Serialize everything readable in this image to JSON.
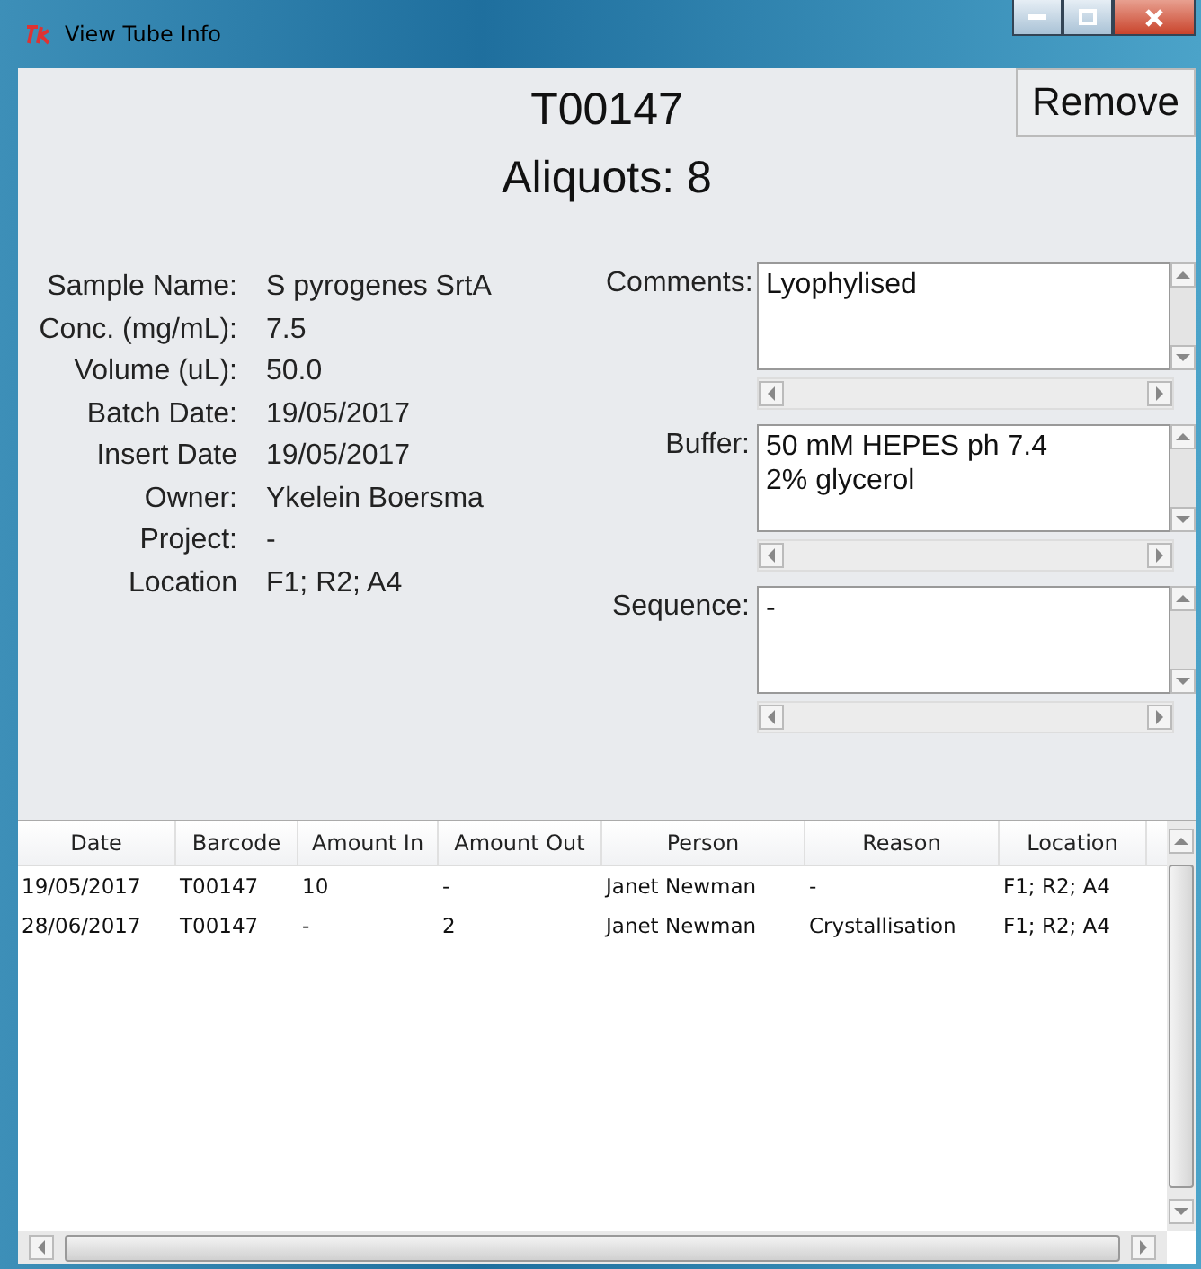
{
  "window": {
    "title": "View Tube Info"
  },
  "header": {
    "tube_id": "T00147",
    "aliquots": "Aliquots: 8",
    "remove_button": "Remove"
  },
  "fields": [
    {
      "label": "Sample Name:",
      "value": "S pyrogenes SrtA"
    },
    {
      "label": "Conc. (mg/mL):",
      "value": "7.5"
    },
    {
      "label": "Volume (uL):",
      "value": "50.0"
    },
    {
      "label": "Batch Date:",
      "value": "19/05/2017"
    },
    {
      "label": "Insert Date",
      "value": "19/05/2017"
    },
    {
      "label": "Owner:",
      "value": "Ykelein Boersma"
    },
    {
      "label": "Project:",
      "value": "-"
    },
    {
      "label": "Location",
      "value": "F1; R2; A4"
    }
  ],
  "text_areas": [
    {
      "label": "Comments:",
      "lines": [
        "Lyophylised"
      ]
    },
    {
      "label": "Buffer:",
      "lines": [
        "50 mM HEPES ph 7.4",
        "2% glycerol"
      ]
    },
    {
      "label": "Sequence:",
      "lines": [
        "-"
      ]
    }
  ],
  "table": {
    "columns": [
      "Date",
      "Barcode",
      "Amount In",
      "Amount Out",
      "Person",
      "Reason",
      "Location"
    ],
    "rows": [
      [
        "19/05/2017",
        "T00147",
        "10",
        "-",
        "Janet Newman",
        "-",
        "F1; R2; A4"
      ],
      [
        "28/06/2017",
        "T00147",
        "-",
        "2",
        "Janet Newman",
        "Crystallisation",
        "F1; R2; A4"
      ]
    ]
  }
}
